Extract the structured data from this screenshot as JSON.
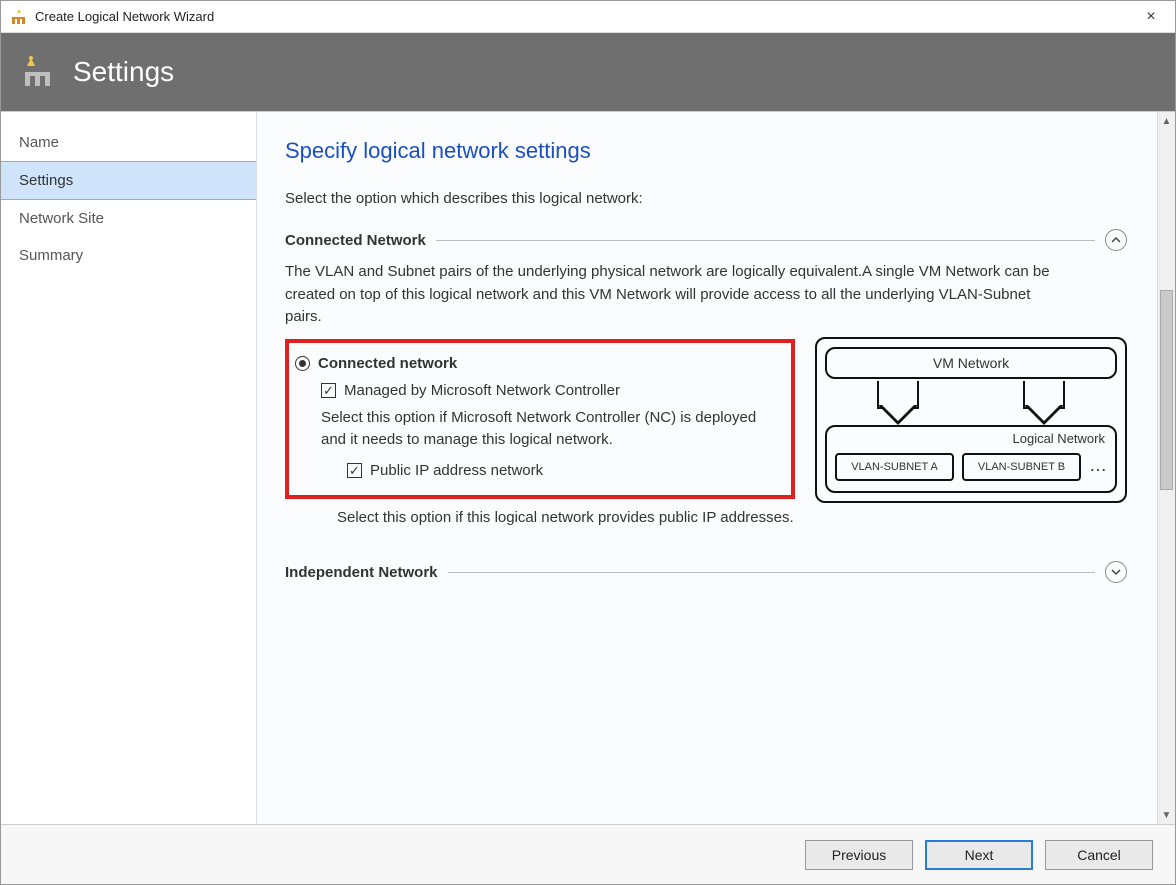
{
  "window": {
    "title": "Create Logical Network Wizard",
    "close_glyph": "×"
  },
  "header": {
    "title": "Settings"
  },
  "sidebar": {
    "items": [
      {
        "label": "Name",
        "active": false
      },
      {
        "label": "Settings",
        "active": true
      },
      {
        "label": "Network Site",
        "active": false
      },
      {
        "label": "Summary",
        "active": false
      }
    ]
  },
  "content": {
    "heading": "Specify logical network settings",
    "lead": "Select the option which describes this logical network:",
    "connected": {
      "section_title": "Connected Network",
      "desc": "The VLAN and Subnet pairs of the underlying physical network are logically equivalent.A single VM Network can be created on top of this logical network and this VM Network will provide access to all the underlying VLAN-Subnet pairs.",
      "radio_label": "Connected network",
      "radio_checked": true,
      "managed_label": "Managed by Microsoft Network Controller",
      "managed_checked": true,
      "managed_hint": "Select this option if Microsoft Network Controller (NC) is deployed and it needs to manage this logical network.",
      "public_ip_label": "Public IP address network",
      "public_ip_checked": true,
      "public_ip_hint": "Select this option if this logical network provides public IP addresses."
    },
    "independent": {
      "section_title": "Independent Network"
    },
    "diagram": {
      "vm_label": "VM Network",
      "logical_label": "Logical  Network",
      "subnet_a": "VLAN-SUBNET A",
      "subnet_b": "VLAN-SUBNET B",
      "dots": "…"
    }
  },
  "footer": {
    "previous": "Previous",
    "next": "Next",
    "cancel": "Cancel"
  }
}
